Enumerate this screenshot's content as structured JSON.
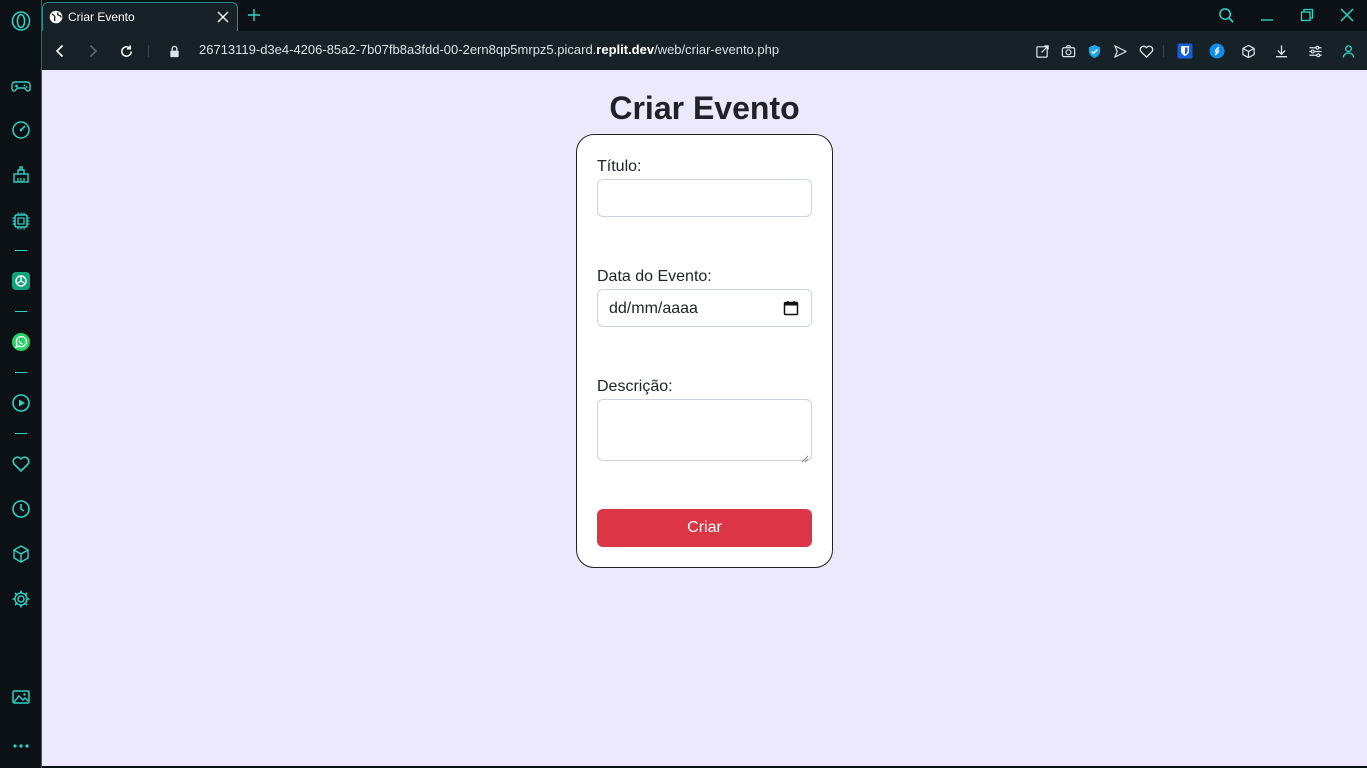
{
  "browser": {
    "tab_title": "Criar Evento",
    "url_prefix": "26713119-d3e4-4206-85a2-7b07fb8a3fdd-00-2ern8qp5mrpz5.picard.",
    "url_host": "replit.dev",
    "url_path": "/web/criar-evento.php",
    "accent_color": "#2fd3c6"
  },
  "page": {
    "title": "Criar Evento",
    "background_color": "#ece9fd",
    "form": {
      "titulo_label": "Título:",
      "titulo_value": "",
      "data_label": "Data do Evento:",
      "data_placeholder": "dd/mm/aaaa",
      "descricao_label": "Descrição:",
      "descricao_value": "",
      "submit_label": "Criar",
      "submit_color": "#dc3545"
    }
  }
}
